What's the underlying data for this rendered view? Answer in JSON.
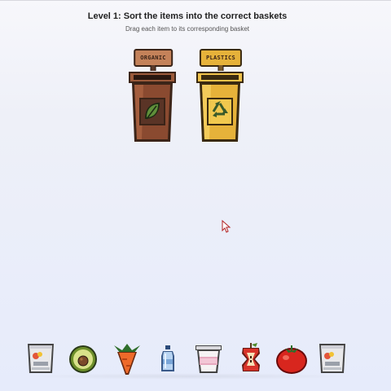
{
  "game": {
    "title": "Level 1: Sort the items into the correct baskets",
    "subtitle": "Drag each item to its corresponding basket"
  },
  "baskets": [
    {
      "label": "ORGANIC",
      "color": "#8a4a30",
      "accent": "#c4825a",
      "icon": "leaf-icon"
    },
    {
      "label": "PLASTICS",
      "color": "#e6b23a",
      "accent": "#b7841f",
      "icon": "recycle-icon"
    }
  ],
  "items": [
    {
      "name": "chip-bag",
      "icon": "chip-bag-icon"
    },
    {
      "name": "avocado",
      "icon": "avocado-icon"
    },
    {
      "name": "carrot",
      "icon": "carrot-icon"
    },
    {
      "name": "water-bottle",
      "icon": "water-bottle-icon"
    },
    {
      "name": "yogurt-cup",
      "icon": "yogurt-cup-icon"
    },
    {
      "name": "apple-core",
      "icon": "apple-core-icon"
    },
    {
      "name": "tomato",
      "icon": "tomato-icon"
    },
    {
      "name": "chip-bag",
      "icon": "chip-bag-icon"
    }
  ],
  "cursor": {
    "icon": "mouse-pointer-icon"
  }
}
